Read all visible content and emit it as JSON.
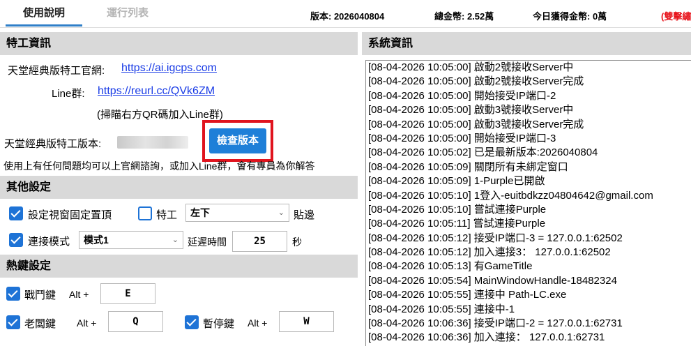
{
  "tabs": {
    "help": "使用說明",
    "run_list": "運行列表"
  },
  "header": {
    "version": "版本: 2026040804",
    "total_coins": "總金幣:  2.52萬",
    "today_coins": "今日獲得金幣:  0萬",
    "mode_badge": "(雙擊繡"
  },
  "agent_info": {
    "title": "特工資訊",
    "official_site_label": "天堂經典版特工官網:",
    "official_site_url": "https://ai.igcps.com",
    "line_label": "Line群:",
    "line_url": "https://reurl.cc/QVk6ZM",
    "qr_hint": "(掃瞄右方QR碼加入Line群)",
    "version_label": "天堂經典版特工版本:",
    "check_version_button": "檢查版本",
    "help_text": "使用上有任何問題均可以上官網諮詢，或加入Line群，會有專員為你解答"
  },
  "other_settings": {
    "title": "其他設定",
    "pin_window_label": "設定視窗固定置頂",
    "pin_window_checked": true,
    "agent_label": "特工",
    "agent_checked": false,
    "dock_position": "左下",
    "dock_suffix": "貼邊",
    "connect_mode_label": "連接模式",
    "connect_mode_checked": true,
    "connect_mode_value": "模式1",
    "delay_label": "延遲時間",
    "delay_value": "25",
    "delay_unit": "秒"
  },
  "hotkeys": {
    "title": "熱鍵設定",
    "battle_label": "戰鬥鍵",
    "battle_checked": true,
    "battle_modifier": "Alt +",
    "battle_key": "E",
    "boss_label": "老闆鍵",
    "boss_checked": true,
    "boss_modifier": "Alt +",
    "boss_key": "Q",
    "pause_label": "暫停鍵",
    "pause_checked": true,
    "pause_modifier": "Alt +",
    "pause_key": "W"
  },
  "system_info": {
    "title": "系統資訊",
    "log": [
      "[08-04-2026 10:05:00] 啟動2號接收Server中",
      "[08-04-2026 10:05:00] 啟動2號接收Server完成",
      "[08-04-2026 10:05:00] 開始接受IP端口-2",
      "[08-04-2026 10:05:00] 啟動3號接收Server中",
      "[08-04-2026 10:05:00] 啟動3號接收Server完成",
      "[08-04-2026 10:05:00] 開始接受IP端口-3",
      "[08-04-2026 10:05:02] 已是最新版本:2026040804",
      "[08-04-2026 10:05:09] 關閉所有未綁定窗口",
      "[08-04-2026 10:05:09] 1-Purple已開啟",
      "[08-04-2026 10:05:10] 1登入-euitbdkzz04804642@gmail.com",
      "[08-04-2026 10:05:10] 嘗試連接Purple",
      "[08-04-2026 10:05:11] 嘗試連接Purple",
      "[08-04-2026 10:05:12] 接受IP端口-3 =  127.0.0.1:62502",
      "[08-04-2026 10:05:12] 加入連接3：  127.0.0.1:62502",
      "[08-04-2026 10:05:13] 有GameTitle",
      "[08-04-2026 10:05:54] MainWindowHandle-18482324",
      "[08-04-2026 10:05:55] 連接中 Path-LC.exe",
      "[08-04-2026 10:05:55] 連接中-1",
      "[08-04-2026 10:06:36] 接受IP端口-2 =  127.0.0.1:62731",
      "[08-04-2026 10:06:36] 加入連接：  127.0.0.1:62731"
    ]
  },
  "colors": {
    "accent": "#1e73d6",
    "highlight": "#e0141e",
    "section_bg": "#d9d9d9",
    "link": "#1a3ce6"
  }
}
